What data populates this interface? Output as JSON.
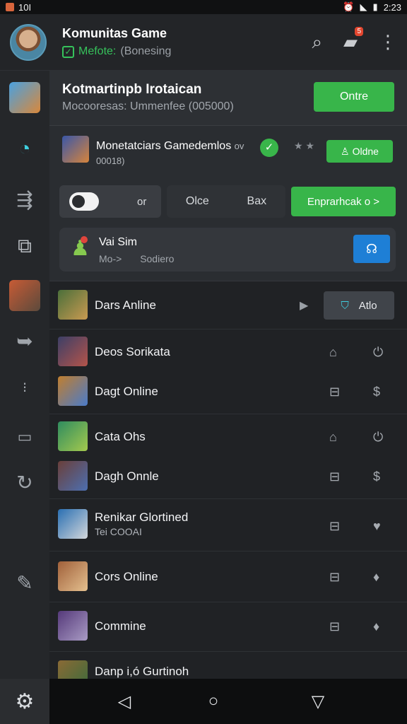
{
  "status": {
    "time_left": "10I",
    "time_right": "2:23"
  },
  "header": {
    "title": "Komunitas Game",
    "status_text": "Mefote:",
    "status_extra": "(Bonesing",
    "notif_count": "5"
  },
  "panel": {
    "section1": {
      "title": "Kotmartinpb Irotaican",
      "subtitle": "Mocooresas: Ummenfee (005000)",
      "button": "Ontre"
    },
    "section2": {
      "name": "Monetatciars Gamedemlos",
      "name_suffix": "ov",
      "sub": "00018)",
      "stars": "★ ★",
      "button": "Oldne"
    },
    "chips": {
      "toggle_text": "or",
      "seg1": "Olce",
      "seg2": "Bax",
      "cta": "Enprarhcak o >"
    },
    "voice": {
      "title": "Vai Sim",
      "sub1": "Mo->",
      "sub2": "Sodiero"
    }
  },
  "list": [
    {
      "label": "Dars Anline",
      "sub": "",
      "chip": "Atlo"
    },
    {
      "label": "Deos Sorikata",
      "sub": ""
    },
    {
      "label": "Dagt Online",
      "sub": ""
    },
    {
      "label": "Cata Ohs",
      "sub": ""
    },
    {
      "label": "Dagh Onnle",
      "sub": ""
    },
    {
      "label": "Renikar Glortined",
      "sub": "Tei COOAI"
    },
    {
      "label": "Cors Online",
      "sub": ""
    },
    {
      "label": "Commine",
      "sub": ""
    },
    {
      "label": "Danp i,ó Gurtinoh",
      "sub": ""
    }
  ],
  "colors": {
    "accent_green": "#38b54a",
    "accent_blue": "#1e7fd6",
    "badge_red": "#e2462f"
  },
  "icons": {
    "header": [
      "search-icon",
      "chat-icon",
      "more-vert-icon"
    ],
    "sidebar": [
      "game-thumb",
      "loader-icon",
      "forward-icon",
      "game-add-icon",
      "game-thumb",
      "share-icon",
      "dots-icon",
      "window-icon",
      "refresh-icon",
      "edit-icon"
    ],
    "bottom": [
      "settings-icon",
      "back-icon",
      "home-icon",
      "recents-icon"
    ]
  }
}
